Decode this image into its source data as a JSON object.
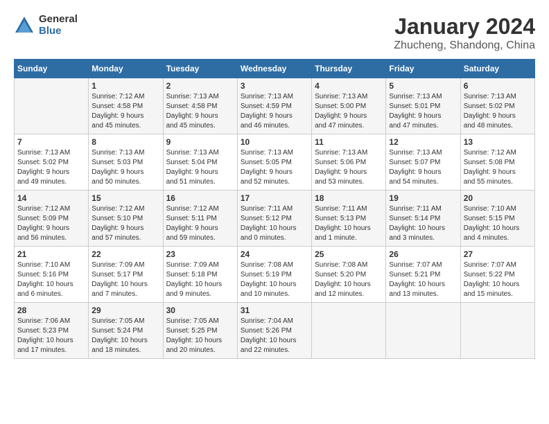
{
  "header": {
    "logo_general": "General",
    "logo_blue": "Blue",
    "month_title": "January 2024",
    "location": "Zhucheng, Shandong, China"
  },
  "days_of_week": [
    "Sunday",
    "Monday",
    "Tuesday",
    "Wednesday",
    "Thursday",
    "Friday",
    "Saturday"
  ],
  "weeks": [
    [
      {
        "day": "",
        "info": ""
      },
      {
        "day": "1",
        "info": "Sunrise: 7:12 AM\nSunset: 4:58 PM\nDaylight: 9 hours\nand 45 minutes."
      },
      {
        "day": "2",
        "info": "Sunrise: 7:13 AM\nSunset: 4:58 PM\nDaylight: 9 hours\nand 45 minutes."
      },
      {
        "day": "3",
        "info": "Sunrise: 7:13 AM\nSunset: 4:59 PM\nDaylight: 9 hours\nand 46 minutes."
      },
      {
        "day": "4",
        "info": "Sunrise: 7:13 AM\nSunset: 5:00 PM\nDaylight: 9 hours\nand 47 minutes."
      },
      {
        "day": "5",
        "info": "Sunrise: 7:13 AM\nSunset: 5:01 PM\nDaylight: 9 hours\nand 47 minutes."
      },
      {
        "day": "6",
        "info": "Sunrise: 7:13 AM\nSunset: 5:02 PM\nDaylight: 9 hours\nand 48 minutes."
      }
    ],
    [
      {
        "day": "7",
        "info": "Sunrise: 7:13 AM\nSunset: 5:02 PM\nDaylight: 9 hours\nand 49 minutes."
      },
      {
        "day": "8",
        "info": "Sunrise: 7:13 AM\nSunset: 5:03 PM\nDaylight: 9 hours\nand 50 minutes."
      },
      {
        "day": "9",
        "info": "Sunrise: 7:13 AM\nSunset: 5:04 PM\nDaylight: 9 hours\nand 51 minutes."
      },
      {
        "day": "10",
        "info": "Sunrise: 7:13 AM\nSunset: 5:05 PM\nDaylight: 9 hours\nand 52 minutes."
      },
      {
        "day": "11",
        "info": "Sunrise: 7:13 AM\nSunset: 5:06 PM\nDaylight: 9 hours\nand 53 minutes."
      },
      {
        "day": "12",
        "info": "Sunrise: 7:13 AM\nSunset: 5:07 PM\nDaylight: 9 hours\nand 54 minutes."
      },
      {
        "day": "13",
        "info": "Sunrise: 7:12 AM\nSunset: 5:08 PM\nDaylight: 9 hours\nand 55 minutes."
      }
    ],
    [
      {
        "day": "14",
        "info": "Sunrise: 7:12 AM\nSunset: 5:09 PM\nDaylight: 9 hours\nand 56 minutes."
      },
      {
        "day": "15",
        "info": "Sunrise: 7:12 AM\nSunset: 5:10 PM\nDaylight: 9 hours\nand 57 minutes."
      },
      {
        "day": "16",
        "info": "Sunrise: 7:12 AM\nSunset: 5:11 PM\nDaylight: 9 hours\nand 59 minutes."
      },
      {
        "day": "17",
        "info": "Sunrise: 7:11 AM\nSunset: 5:12 PM\nDaylight: 10 hours\nand 0 minutes."
      },
      {
        "day": "18",
        "info": "Sunrise: 7:11 AM\nSunset: 5:13 PM\nDaylight: 10 hours\nand 1 minute."
      },
      {
        "day": "19",
        "info": "Sunrise: 7:11 AM\nSunset: 5:14 PM\nDaylight: 10 hours\nand 3 minutes."
      },
      {
        "day": "20",
        "info": "Sunrise: 7:10 AM\nSunset: 5:15 PM\nDaylight: 10 hours\nand 4 minutes."
      }
    ],
    [
      {
        "day": "21",
        "info": "Sunrise: 7:10 AM\nSunset: 5:16 PM\nDaylight: 10 hours\nand 6 minutes."
      },
      {
        "day": "22",
        "info": "Sunrise: 7:09 AM\nSunset: 5:17 PM\nDaylight: 10 hours\nand 7 minutes."
      },
      {
        "day": "23",
        "info": "Sunrise: 7:09 AM\nSunset: 5:18 PM\nDaylight: 10 hours\nand 9 minutes."
      },
      {
        "day": "24",
        "info": "Sunrise: 7:08 AM\nSunset: 5:19 PM\nDaylight: 10 hours\nand 10 minutes."
      },
      {
        "day": "25",
        "info": "Sunrise: 7:08 AM\nSunset: 5:20 PM\nDaylight: 10 hours\nand 12 minutes."
      },
      {
        "day": "26",
        "info": "Sunrise: 7:07 AM\nSunset: 5:21 PM\nDaylight: 10 hours\nand 13 minutes."
      },
      {
        "day": "27",
        "info": "Sunrise: 7:07 AM\nSunset: 5:22 PM\nDaylight: 10 hours\nand 15 minutes."
      }
    ],
    [
      {
        "day": "28",
        "info": "Sunrise: 7:06 AM\nSunset: 5:23 PM\nDaylight: 10 hours\nand 17 minutes."
      },
      {
        "day": "29",
        "info": "Sunrise: 7:05 AM\nSunset: 5:24 PM\nDaylight: 10 hours\nand 18 minutes."
      },
      {
        "day": "30",
        "info": "Sunrise: 7:05 AM\nSunset: 5:25 PM\nDaylight: 10 hours\nand 20 minutes."
      },
      {
        "day": "31",
        "info": "Sunrise: 7:04 AM\nSunset: 5:26 PM\nDaylight: 10 hours\nand 22 minutes."
      },
      {
        "day": "",
        "info": ""
      },
      {
        "day": "",
        "info": ""
      },
      {
        "day": "",
        "info": ""
      }
    ]
  ]
}
